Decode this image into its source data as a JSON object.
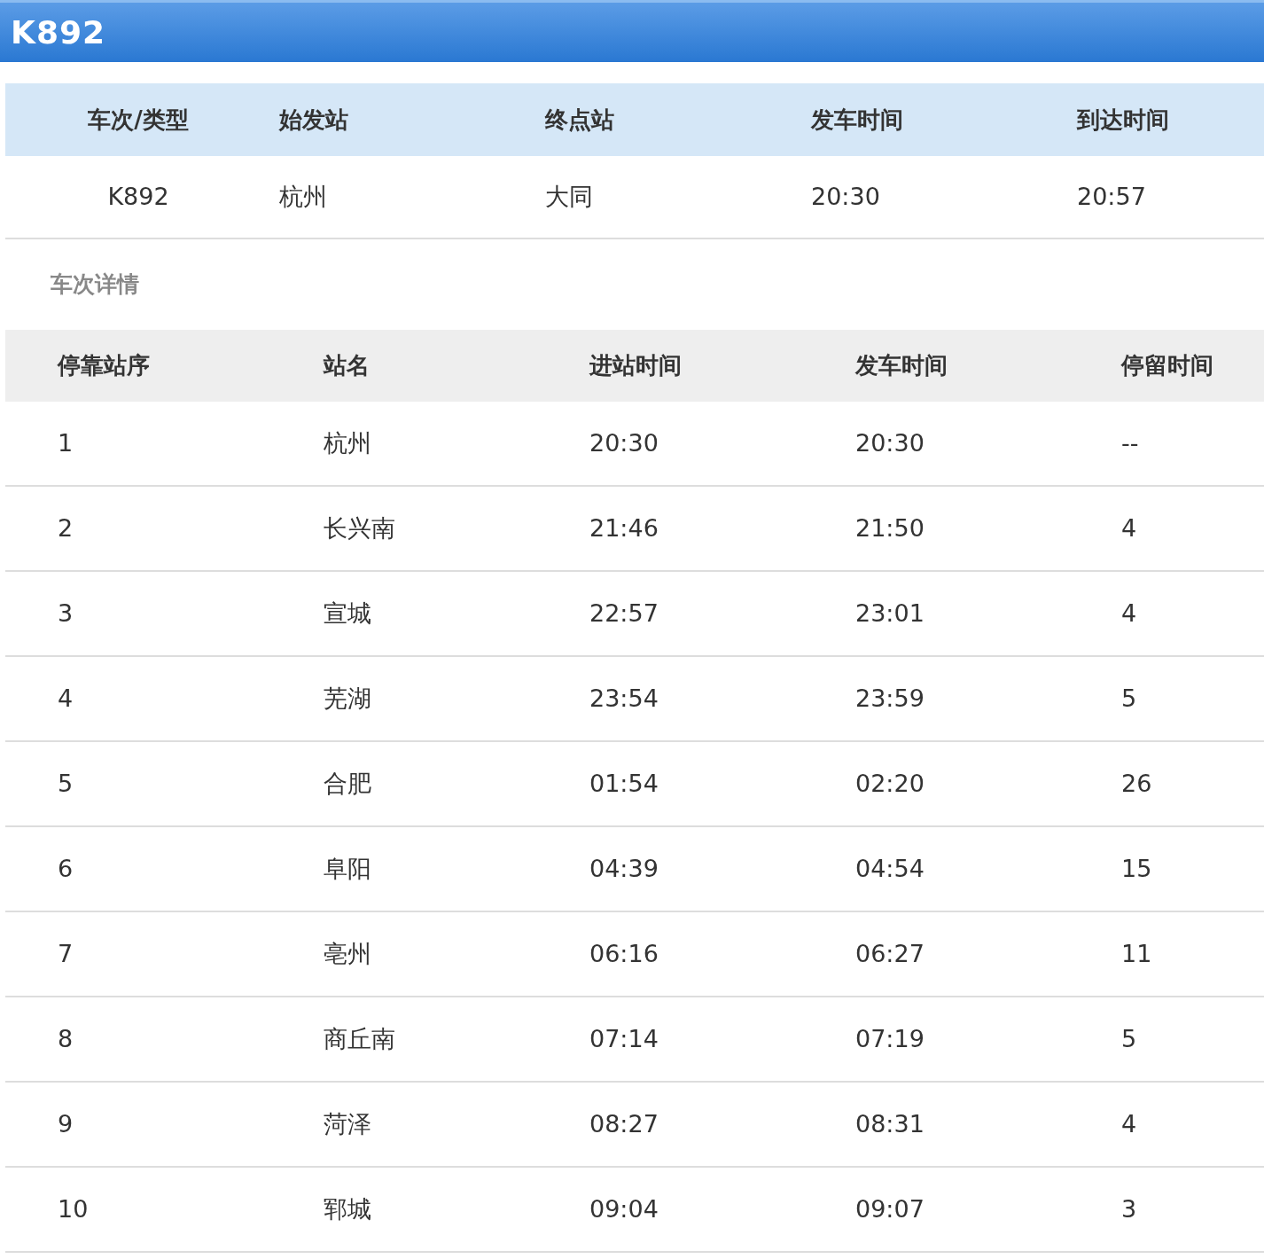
{
  "header": {
    "title": "K892"
  },
  "summary": {
    "columns": [
      "车次/类型",
      "始发站",
      "终点站",
      "发车时间",
      "到达时间"
    ],
    "rows": [
      [
        "K892",
        "杭州",
        "大同",
        "20:30",
        "20:57"
      ]
    ]
  },
  "details_label": "车次详情",
  "stops": {
    "columns": [
      "停靠站序",
      "站名",
      "进站时间",
      "发车时间",
      "停留时间"
    ],
    "rows": [
      [
        "1",
        "杭州",
        "20:30",
        "20:30",
        "--"
      ],
      [
        "2",
        "长兴南",
        "21:46",
        "21:50",
        "4"
      ],
      [
        "3",
        "宣城",
        "22:57",
        "23:01",
        "4"
      ],
      [
        "4",
        "芜湖",
        "23:54",
        "23:59",
        "5"
      ],
      [
        "5",
        "合肥",
        "01:54",
        "02:20",
        "26"
      ],
      [
        "6",
        "阜阳",
        "04:39",
        "04:54",
        "15"
      ],
      [
        "7",
        "亳州",
        "06:16",
        "06:27",
        "11"
      ],
      [
        "8",
        "商丘南",
        "07:14",
        "07:19",
        "5"
      ],
      [
        "9",
        "菏泽",
        "08:27",
        "08:31",
        "4"
      ],
      [
        "10",
        "郓城",
        "09:04",
        "09:07",
        "3"
      ]
    ]
  }
}
